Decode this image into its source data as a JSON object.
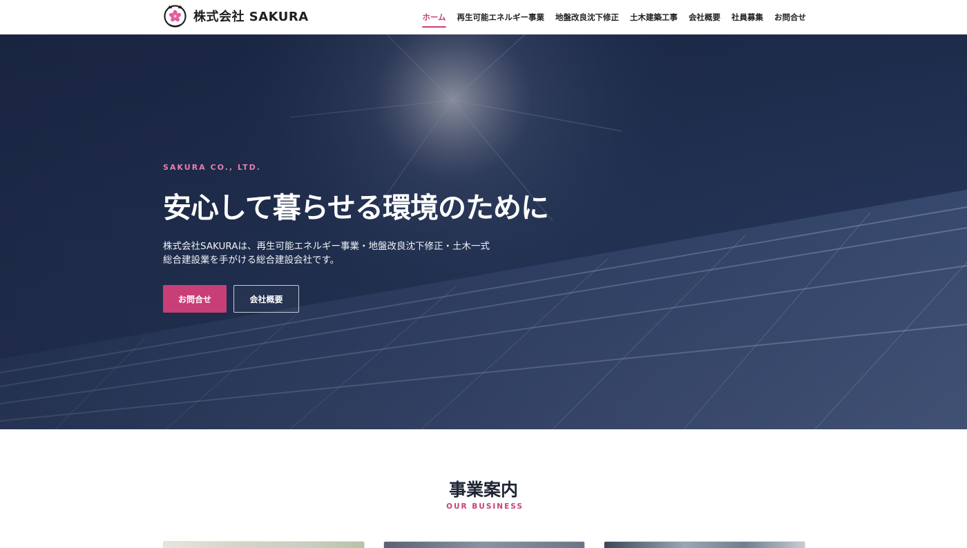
{
  "header": {
    "logo_text": "株式会社 SAKURA",
    "nav": [
      {
        "label": "ホーム",
        "active": true
      },
      {
        "label": "再生可能エネルギー事業",
        "active": false
      },
      {
        "label": "地盤改良沈下修正",
        "active": false
      },
      {
        "label": "土木建築工事",
        "active": false
      },
      {
        "label": "会社概要",
        "active": false
      },
      {
        "label": "社員募集",
        "active": false
      },
      {
        "label": "お問合せ",
        "active": false
      }
    ]
  },
  "hero": {
    "eyebrow": "SAKURA CO., LTD.",
    "title": "安心して暮らせる環境のために",
    "description": "株式会社SAKURAは、再生可能エネルギー事業・地盤改良沈下修正・土木一式総合建設業を手がける総合建設会社です。",
    "primary_button": "お問合せ",
    "secondary_button": "会社概要",
    "background": "solar-panels-under-sun"
  },
  "business": {
    "title": "事業案内",
    "subtitle": "OUR BUSINESS"
  },
  "colors": {
    "accent": "#c83f78",
    "hero_dark": "#253558"
  }
}
